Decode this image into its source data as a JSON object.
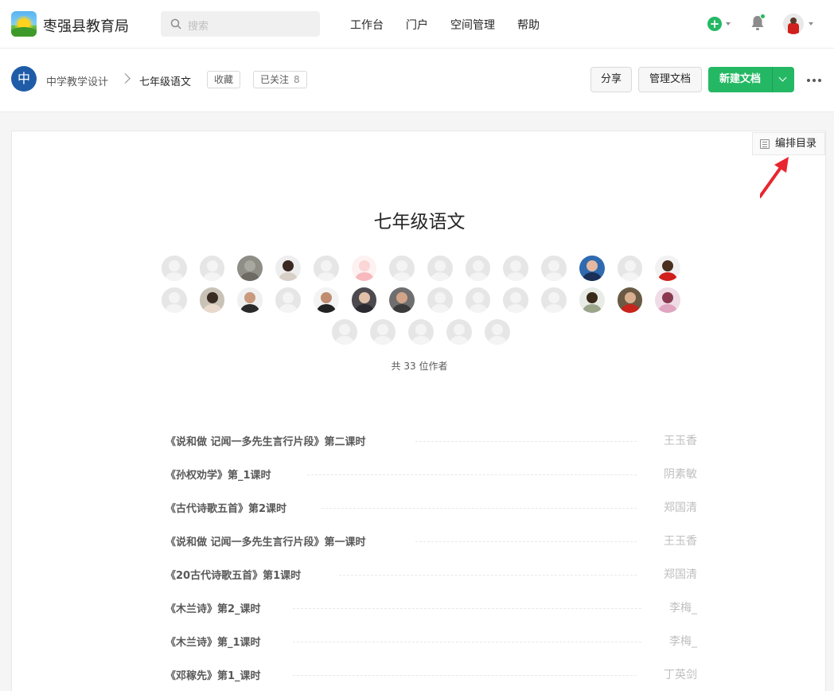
{
  "app": {
    "name": "枣强县教育局"
  },
  "search": {
    "placeholder": "搜索"
  },
  "nav": {
    "items": [
      "工作台",
      "门户",
      "空间管理",
      "帮助"
    ]
  },
  "space": {
    "badge": "中",
    "breadcrumb": [
      "中学教学设计",
      "七年级语文"
    ],
    "favorite_label": "收藏",
    "followed_label": "已关注",
    "followed_count": "8"
  },
  "actions": {
    "share": "分享",
    "manage_docs": "管理文档",
    "new_doc": "新建文档"
  },
  "toc_button": "编排目录",
  "book": {
    "title": "七年级语文",
    "authors_count_text": "共 33 位作者",
    "author_avatar_rows": [
      14,
      14,
      5
    ]
  },
  "documents": [
    {
      "title": "《说和做 记闻一多先生言行片段》第二课时",
      "author": "王玉香"
    },
    {
      "title": "《孙权劝学》第_1课时",
      "author": "阴素敏"
    },
    {
      "title": "《古代诗歌五首》第2课时",
      "author": "郑国清"
    },
    {
      "title": "《说和做 记闻一多先生言行片段》第一课时",
      "author": "王玉香"
    },
    {
      "title": "《20古代诗歌五首》第1课时",
      "author": "郑国清"
    },
    {
      "title": "《木兰诗》第2_课时",
      "author": "李梅_"
    },
    {
      "title": "《木兰诗》第_1课时",
      "author": "李梅_"
    },
    {
      "title": "《邓稼先》第1_课时",
      "author": "丁英剑"
    }
  ],
  "colors": {
    "primary": "#25b864",
    "space_badge": "#1f5ca8",
    "annotation_arrow": "#e8262f"
  }
}
